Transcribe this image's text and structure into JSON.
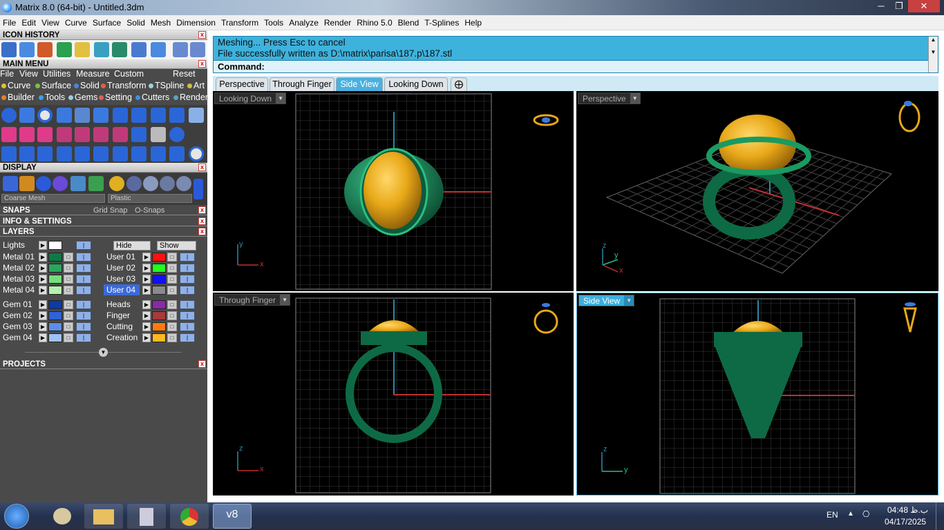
{
  "window": {
    "title": "Matrix 8.0 (64-bit) - Untitled.3dm",
    "minimize_icon": "minimize-icon",
    "maximize_icon": "restore-icon",
    "close_icon": "close-icon"
  },
  "menubar": {
    "items": [
      "File",
      "Edit",
      "View",
      "Curve",
      "Surface",
      "Solid",
      "Mesh",
      "Dimension",
      "Transform",
      "Tools",
      "Analyze",
      "Render",
      "Rhino 5.0",
      "Blend",
      "T-Splines",
      "Help"
    ]
  },
  "panels": {
    "icon_history": "ICON HISTORY",
    "main_menu": "MAIN MENU",
    "main_menu_items": [
      "File",
      "View",
      "Utilities",
      "Measure",
      "Custom",
      "Reset"
    ],
    "row1": [
      "Curve",
      "Surface",
      "Solid",
      "Transform",
      "TSpline",
      "Art"
    ],
    "row1_colors": [
      "#e0c030",
      "#7ec040",
      "#5080e0",
      "#e06040",
      "#9ad0e0",
      "#d0c040"
    ],
    "row2": [
      "Builder",
      "Tools",
      "Gems",
      "Setting",
      "Cutters",
      "Render"
    ],
    "row2_colors": [
      "#e08030",
      "#40a0e0",
      "#9ad0e0",
      "#e06060",
      "#4090e0",
      "#60a0c0"
    ],
    "display": "DISPLAY",
    "mesh_select": "Coarse Mesh",
    "material_select": "Plastic",
    "snaps": "SNAPS",
    "grid_snap": "Grid Snap",
    "osnaps": "O-Snaps",
    "info": "INFO & SETTINGS",
    "layers": "LAYERS",
    "projects": "PROJECTS"
  },
  "layers": {
    "lights": "Lights",
    "hide": "Hide",
    "show": "Show",
    "left": [
      {
        "name": "Metal 01",
        "color": "#0d7a43"
      },
      {
        "name": "Metal 02",
        "color": "#27a85c"
      },
      {
        "name": "Metal 03",
        "color": "#74e07c"
      },
      {
        "name": "Metal 04",
        "color": "#b6f0b0"
      }
    ],
    "right": [
      {
        "name": "User 01",
        "color": "#ff1010"
      },
      {
        "name": "User 02",
        "color": "#20ff20"
      },
      {
        "name": "User 03",
        "color": "#1010ff"
      },
      {
        "name": "User 04",
        "color": "#8a8a8a"
      }
    ],
    "gems": [
      {
        "name": "Gem 01",
        "color": "#0e3aa8"
      },
      {
        "name": "Gem 02",
        "color": "#2e62d8"
      },
      {
        "name": "Gem 03",
        "color": "#5c8ee8"
      },
      {
        "name": "Gem 04",
        "color": "#9ec0f4"
      }
    ],
    "other": [
      {
        "name": "Heads",
        "color": "#8a2aa8"
      },
      {
        "name": "Finger",
        "color": "#a83a3a"
      },
      {
        "name": "Cutting",
        "color": "#ff7a10"
      },
      {
        "name": "Creation",
        "color": "#ffb820"
      }
    ]
  },
  "command": {
    "line1": "Meshing... Press Esc to cancel",
    "line2": "File successfully written as D:\\matrix\\parisa\\187.p\\187.stl",
    "prompt": "Command:"
  },
  "tabs": [
    "Perspective",
    "Through Finger",
    "Side View",
    "Looking Down"
  ],
  "active_tab": "Side View",
  "viewports": {
    "top_left": {
      "label": "Looking Down",
      "axes": [
        "y",
        "x"
      ]
    },
    "top_right": {
      "label": "Perspective",
      "axes": [
        "z",
        "y",
        "x"
      ]
    },
    "bottom_left": {
      "label": "Through Finger",
      "axes": [
        "z",
        "x"
      ]
    },
    "bottom_right": {
      "label": "Side View",
      "axes": [
        "z",
        "y"
      ]
    }
  },
  "tray": {
    "lang": "EN",
    "time": "04:48 ب.ظ",
    "date": "04/17/2025"
  }
}
